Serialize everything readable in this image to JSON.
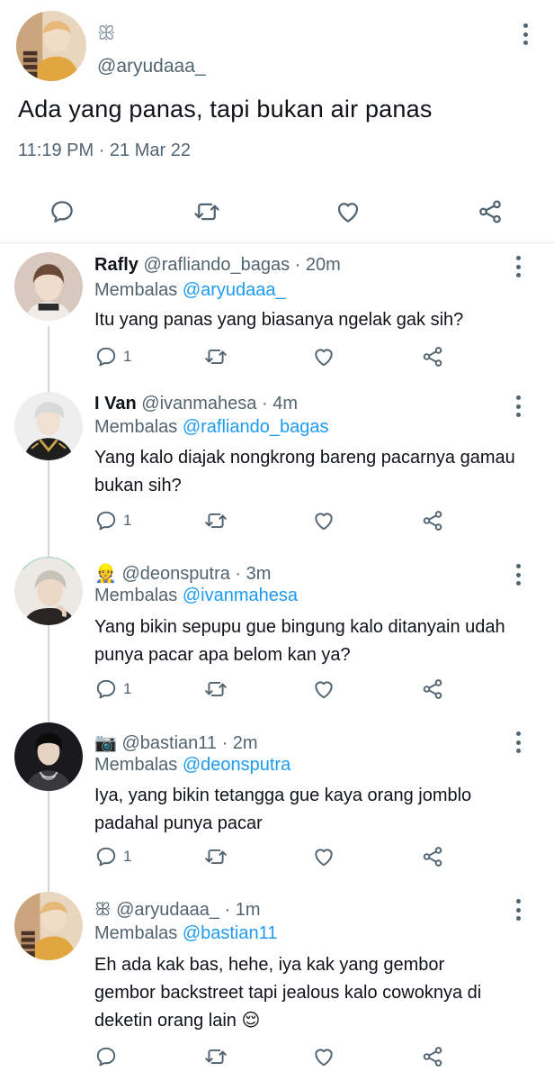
{
  "main_tweet": {
    "emoji": "ꕥ",
    "handle": "@aryudaaa_",
    "text": "Ada yang panas, tapi bukan air panas",
    "timestamp": "11:19 PM · 21 Mar 22"
  },
  "replies": [
    {
      "display_name": "Rafly",
      "handle": "@rafliando_bagas",
      "time": "· 20m",
      "replying_label": "Membalas",
      "replying_to": "@aryudaaa_",
      "body": "Itu yang panas yang biasanya ngelak gak sih?",
      "reply_count": "1"
    },
    {
      "display_name": "I Van",
      "handle": "@ivanmahesa",
      "time": "· 4m",
      "replying_label": "Membalas",
      "replying_to": "@rafliando_bagas",
      "body": "Yang kalo diajak nongkrong bareng pacarnya gamau bukan sih?",
      "reply_count": "1"
    },
    {
      "display_name": "👷",
      "handle": "@deonsputra",
      "time": "· 3m",
      "replying_label": "Membalas",
      "replying_to": "@ivanmahesa",
      "body": "Yang bikin sepupu gue bingung kalo ditanyain udah punya pacar apa belom kan ya?",
      "reply_count": "1"
    },
    {
      "display_name": "📷",
      "handle": "@bastian11",
      "time": "· 2m",
      "replying_label": "Membalas",
      "replying_to": "@deonsputra",
      "body": "Iya, yang bikin tetangga gue kaya orang jomblo padahal punya pacar",
      "reply_count": "1"
    },
    {
      "display_name": "ꕥ",
      "handle": "@aryudaaa_",
      "time": "· 1m",
      "replying_label": "Membalas",
      "replying_to": "@bastian11",
      "body": "Eh ada kak bas, hehe, iya kak yang gembor gembor backstreet tapi jealous kalo cowoknya di deketin orang lain 😌",
      "reply_count": ""
    }
  ],
  "icons": {
    "reply": "reply-icon",
    "retweet": "retweet-icon",
    "like": "like-icon",
    "share": "share-icon",
    "more": "more-icon"
  },
  "colors": {
    "link": "#1d9bf0",
    "muted": "#536471",
    "text": "#0f1419"
  }
}
